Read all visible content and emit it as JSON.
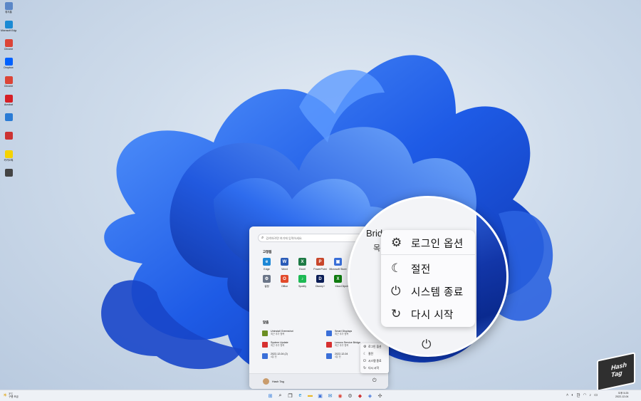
{
  "desktop_icons": [
    {
      "label": "휴지통",
      "icon": "recycle-bin-icon",
      "color": "#5b87c7"
    },
    {
      "label": "Microsoft Edge",
      "icon": "edge-icon",
      "color": "#1a8ad4"
    },
    {
      "label": "Chrome",
      "icon": "chrome-icon",
      "color": "#db4437"
    },
    {
      "label": "Dropbox",
      "icon": "dropbox-icon",
      "color": "#0061fe"
    },
    {
      "label": "Chrome",
      "icon": "chrome-icon",
      "color": "#db4437"
    },
    {
      "label": "Acrobat",
      "icon": "acrobat-icon",
      "color": "#d61f26"
    },
    {
      "label": "",
      "icon": "app-icon",
      "color": "#2a7bd5"
    },
    {
      "label": "",
      "icon": "app-icon",
      "color": "#cc3333"
    },
    {
      "label": "카카오톡",
      "icon": "kakao-icon",
      "color": "#f5d300"
    },
    {
      "label": "",
      "icon": "app-icon",
      "color": "#444444"
    }
  ],
  "start_menu": {
    "search_placeholder": "검색하려면 여기에 입력하세요.",
    "pinned_title": "고정됨",
    "pinned": [
      {
        "name": "Edge",
        "color": "#1e88d6",
        "glyph": "e"
      },
      {
        "name": "Word",
        "color": "#2b5cb8",
        "glyph": "W"
      },
      {
        "name": "Excel",
        "color": "#1d7a45",
        "glyph": "X"
      },
      {
        "name": "PowerPoint",
        "color": "#c8462b",
        "glyph": "P"
      },
      {
        "name": "Microsoft Store",
        "color": "#3a6fd8",
        "glyph": "▣"
      },
      {
        "name": "사진",
        "color": "#3c7be0",
        "glyph": "▲"
      },
      {
        "name": "설정",
        "color": "#6a7588",
        "glyph": "⚙"
      },
      {
        "name": "Office",
        "color": "#e24a2b",
        "glyph": "O"
      },
      {
        "name": "Spotify",
        "color": "#1db954",
        "glyph": "♪"
      },
      {
        "name": "Disney+",
        "color": "#0b1d56",
        "glyph": "D"
      },
      {
        "name": "Xbox",
        "color": "#107c10",
        "glyph": "X"
      },
      {
        "name": "Clipchamp - 동영상 편집기",
        "color": "#8a4fd4",
        "glyph": "C"
      }
    ],
    "recommended_title": "맞춤",
    "recommended": [
      {
        "title": "Uninstall Greenshot",
        "sub": "최근 추가 항목",
        "color": "#6b8e23"
      },
      {
        "title": "Smart Displays",
        "sub": "최근 추가 항목",
        "color": "#3a6fd8"
      },
      {
        "title": "System Update",
        "sub": "최근 추가 항목",
        "color": "#d63030"
      },
      {
        "title": "Lenovo Service Bridge",
        "sub": "최근 추가 항목",
        "color": "#d63030"
      },
      {
        "title": "2022-12-04 (2)",
        "sub": "4분 전",
        "color": "#3a6fd8"
      },
      {
        "title": "2022-12-04",
        "sub": "4분 전",
        "color": "#3a6fd8"
      }
    ],
    "user_name": "Hash Tag",
    "power_menu": [
      {
        "label": "로그인 옵션",
        "icon": "gear-icon"
      },
      {
        "label": "절전",
        "icon": "moon-icon"
      },
      {
        "label": "시스템 종료",
        "icon": "power-icon"
      },
      {
        "label": "다시 시작",
        "icon": "restart-icon"
      }
    ]
  },
  "magnifier": {
    "partial_text": "Brid",
    "partial_text2": "목",
    "power_menu": [
      {
        "label": "로그인 옵션",
        "icon": "gear-icon"
      },
      {
        "label": "절전",
        "icon": "moon-icon"
      },
      {
        "label": "시스템 종료",
        "icon": "power-icon"
      },
      {
        "label": "다시 시작",
        "icon": "restart-icon"
      }
    ]
  },
  "taskbar": {
    "weather_temp": "3°C",
    "weather_desc": "구름 조금",
    "clock_time": "오후 5:25",
    "clock_date": "2022-12-04",
    "apps": [
      {
        "name": "start",
        "glyph": "⊞",
        "color": "#1e6fd9"
      },
      {
        "name": "search",
        "glyph": "⌕",
        "color": "#222222"
      },
      {
        "name": "task-view",
        "glyph": "❐",
        "color": "#222222"
      },
      {
        "name": "edge",
        "glyph": "e",
        "color": "#1a8ad4"
      },
      {
        "name": "file-explorer",
        "glyph": "▬",
        "color": "#e8b828"
      },
      {
        "name": "store",
        "glyph": "▣",
        "color": "#3a6fd8"
      },
      {
        "name": "mail",
        "glyph": "✉",
        "color": "#1a6fc7"
      },
      {
        "name": "chrome",
        "glyph": "◉",
        "color": "#db4437"
      },
      {
        "name": "settings",
        "glyph": "⚙",
        "color": "#555555"
      },
      {
        "name": "app",
        "glyph": "◆",
        "color": "#cc3333"
      },
      {
        "name": "app2",
        "glyph": "◈",
        "color": "#3a6fd8"
      },
      {
        "name": "app3",
        "glyph": "✣",
        "color": "#555555"
      }
    ],
    "tray_ime": "한"
  },
  "badge": {
    "line1": "Hash",
    "line2": "Tag"
  }
}
